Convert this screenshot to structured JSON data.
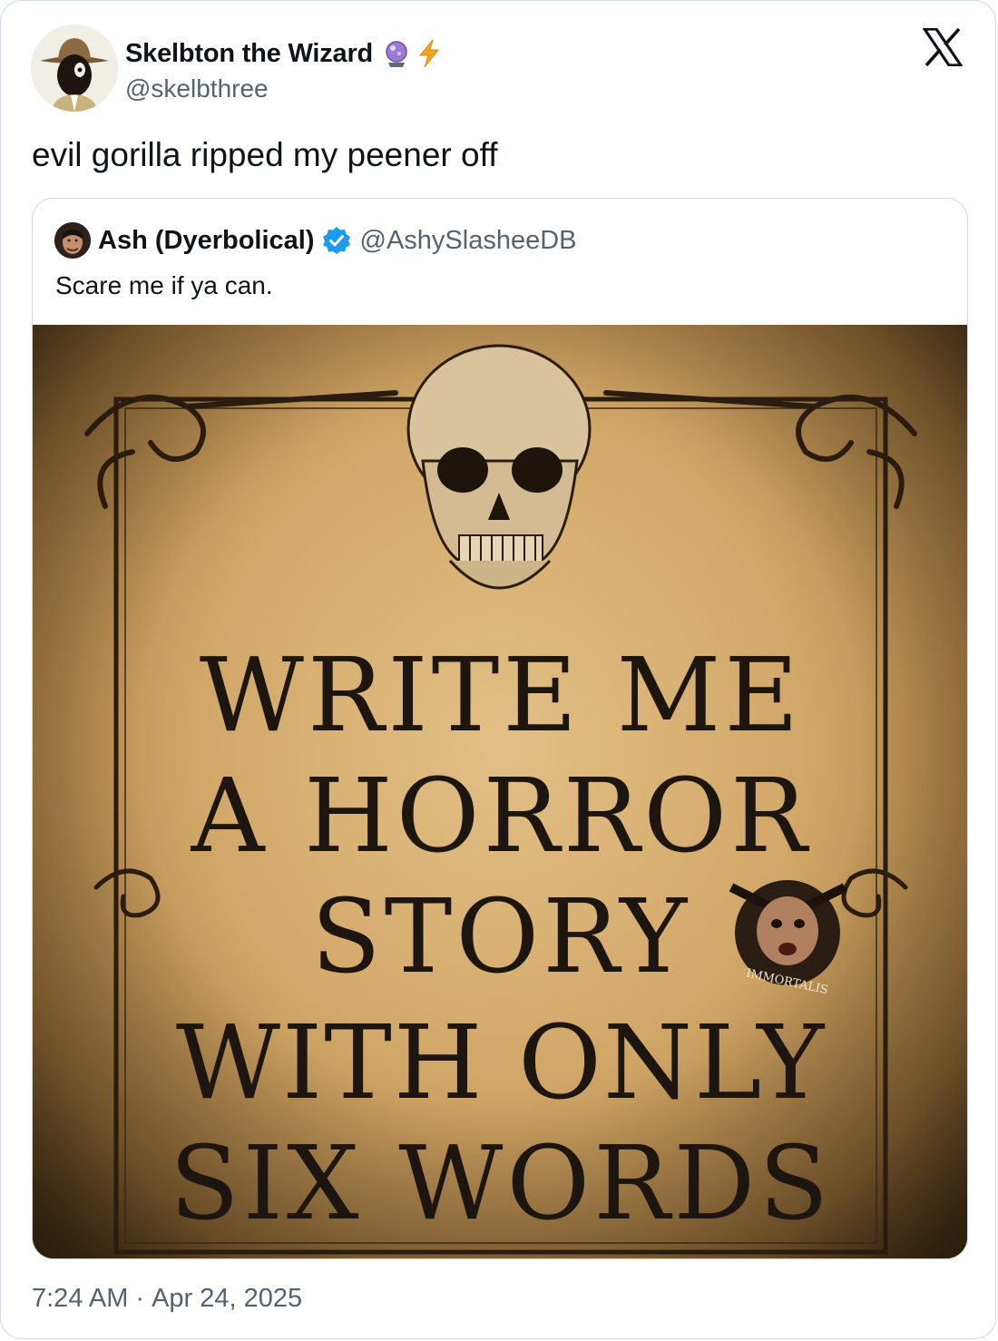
{
  "post": {
    "author": {
      "display_name": "Skelbton the Wizard",
      "handle": "@skelbthree",
      "emoji_icons": [
        "crystal-ball-icon",
        "lightning-icon"
      ]
    },
    "text": "evil gorilla ripped my peener off",
    "timestamp": {
      "time": "7:24 AM",
      "separator": "·",
      "date": "Apr 24, 2025"
    }
  },
  "quoted_post": {
    "author": {
      "display_name": "Ash (Dyerbolical)",
      "handle": "@AshySlasheeDB",
      "verified": true
    },
    "text": "Scare me if ya can.",
    "image": {
      "lines": [
        "WRITE ME",
        "A HORROR",
        "STORY",
        "WITH ONLY",
        "SIX WORDS"
      ],
      "stamp_text": "IMMORTALIS"
    }
  },
  "brand": {
    "logo": "x-logo-icon"
  },
  "colors": {
    "secondary_text": "#536471",
    "verified_blue": "#1d9bf0",
    "border": "#cfd9de"
  }
}
